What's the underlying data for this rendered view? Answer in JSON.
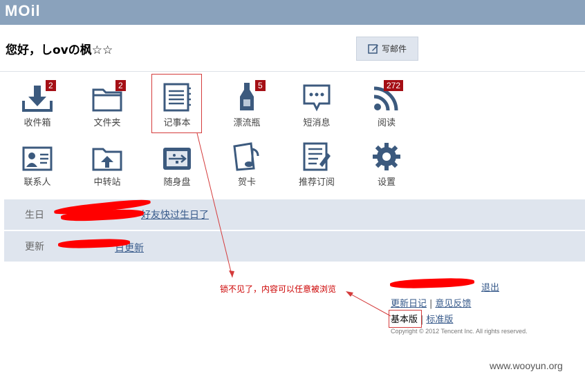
{
  "header": {
    "logo": "MOil"
  },
  "greeting": "您好，しovの枫☆☆",
  "compose": {
    "label": "写邮件"
  },
  "apps": [
    {
      "label": "收件箱",
      "badge": "2",
      "icon": "inbox-download-icon"
    },
    {
      "label": "文件夹",
      "badge": "2",
      "icon": "folder-icon"
    },
    {
      "label": "记事本",
      "badge": "",
      "icon": "notebook-icon"
    },
    {
      "label": "漂流瓶",
      "badge": "5",
      "icon": "bottle-icon"
    },
    {
      "label": "短消息",
      "badge": "",
      "icon": "chat-bubble-icon"
    },
    {
      "label": "阅读",
      "badge": "272",
      "icon": "rss-icon"
    },
    {
      "label": "联系人",
      "badge": "",
      "icon": "contact-card-icon"
    },
    {
      "label": "中转站",
      "badge": "",
      "icon": "folder-upload-icon"
    },
    {
      "label": "随身盘",
      "badge": "",
      "icon": "usb-drive-icon"
    },
    {
      "label": "贺卡",
      "badge": "",
      "icon": "music-card-icon"
    },
    {
      "label": "推荐订阅",
      "badge": "",
      "icon": "subscription-icon"
    },
    {
      "label": "设置",
      "badge": "",
      "icon": "gear-icon"
    }
  ],
  "rows": {
    "birthday": {
      "label": "生日",
      "link": "好友快过生日了"
    },
    "update": {
      "label": "更新",
      "link": "日更新"
    }
  },
  "annotation": "锁不见了，内容可以任意被浏览",
  "footer": {
    "logout": "退出",
    "diary": "更新日记",
    "feedback": "意见反馈",
    "basic": "基本版",
    "standard": "标准版",
    "copyright": "Copyright © 2012 Tencent Inc. All rights reserved."
  },
  "watermark": "www.wooyun.org",
  "colors": {
    "topbar": "#8aa2bc",
    "icon": "#3c5a7e",
    "badge": "#a50f15",
    "annotation": "#cc0000"
  }
}
